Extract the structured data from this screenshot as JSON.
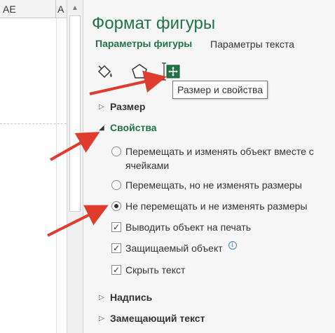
{
  "sheet": {
    "columns": [
      "AE",
      "A"
    ]
  },
  "pane": {
    "title": "Формат фигуры",
    "tabs": [
      {
        "label": "Параметры фигуры",
        "active": true
      },
      {
        "label": "Параметры текста",
        "active": false
      }
    ],
    "icons": [
      "paint-bucket-icon",
      "pentagon-icon",
      "size-properties-icon"
    ],
    "tooltip": "Размер и свойства",
    "sections": {
      "size": {
        "label": "Размер",
        "expanded": false
      },
      "properties": {
        "label": "Свойства",
        "expanded": true
      },
      "caption": {
        "label": "Надпись",
        "expanded": false
      },
      "alt_text": {
        "label": "Замещающий текст",
        "expanded": false
      }
    },
    "radio_options": [
      {
        "label": "Перемещать и изменять объект вместе с ячейками",
        "checked": false
      },
      {
        "label": "Перемещать, но не изменять размеры",
        "checked": false
      },
      {
        "label": "Не перемещать и не изменять размеры",
        "checked": true
      }
    ],
    "checkbox_options": [
      {
        "label": "Выводить объект на печать",
        "checked": true
      },
      {
        "label": "Защищаемый объект",
        "checked": true
      },
      {
        "label": "Скрыть текст",
        "checked": true
      }
    ],
    "info_glyph": "i",
    "colors": {
      "accent": "#217346",
      "annotation_arrow": "#e03c2d"
    }
  }
}
